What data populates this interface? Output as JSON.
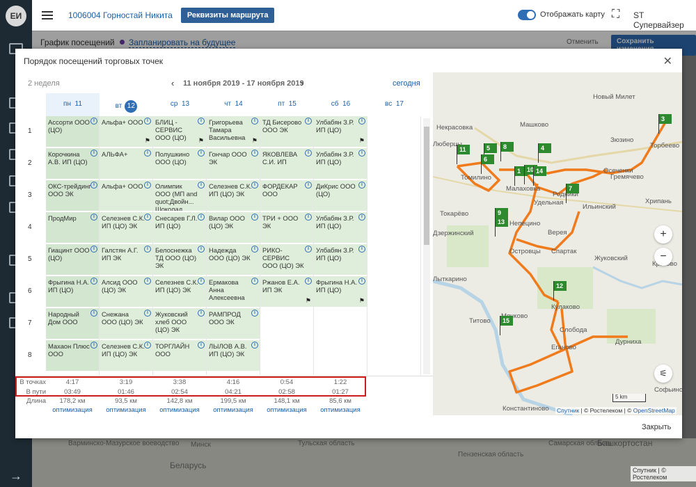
{
  "sidebar": {
    "avatar": "ЕИ"
  },
  "topbar": {
    "name": "1006004 Горностай Никита",
    "route_btn": "Реквизиты маршрута",
    "map_toggle": "Отображать карту",
    "user": "ST Супервайзер"
  },
  "subbar": {
    "title": "График посещений",
    "plan": "Запланировать на будущее",
    "cancel": "Отменить",
    "save": "Сохранить изменения"
  },
  "bg_map": {
    "l1": "Варминско-Мазурское воеводство",
    "l2": "Минск",
    "l3": "Беларусь",
    "l4": "Тульская область",
    "l5": "Пензенская область",
    "l6": "Самарская область",
    "l7": "Башкортостан",
    "attr": "Спутник | © Ростелеком"
  },
  "modal": {
    "title": "Порядок посещений торговых точек",
    "weeks": "2 неделя",
    "range": "11 ноября 2019 - 17 ноября 2019",
    "today": "сегодня",
    "close": "Закрыть",
    "days": [
      {
        "label": "пн",
        "num": "11"
      },
      {
        "label": "вт",
        "num": "12"
      },
      {
        "label": "ср",
        "num": "13"
      },
      {
        "label": "чт",
        "num": "14"
      },
      {
        "label": "пт",
        "num": "15"
      },
      {
        "label": "сб",
        "num": "16"
      },
      {
        "label": "вс",
        "num": "17"
      }
    ],
    "rows": [
      "1",
      "2",
      "3",
      "4",
      "5",
      "6",
      "7",
      "8"
    ],
    "cells": [
      [
        "Ассорти ООО (ЦО)",
        "Альфа+ ООО",
        "БЛИЦ - СЕРВИС ООО (ЦО)",
        "Григорьева Тамара Васильевна",
        "ТД Бисерово ООО ЭК",
        "Улбабян З.Р. ИП (ЦО)"
      ],
      [
        "Корочкина А.В. ИП (ЦО)",
        "АЛЬФА+",
        "Полушкино ООО (ЦО)",
        "Гончар ООО ЭК",
        "ЯКОВЛЕВА С.И. ИП",
        "Улбабян З.Р. ИП (ЦО)"
      ],
      [
        "ОКС-трейдинг ООО ЭК",
        "Альфа+ ООО",
        "Олимпик ООО (МП and quot;Двойн... Шоколад",
        "Селезнев С.К. ИП (ЦО) ЭК",
        "ФОРДЕКАР ООО",
        "ДиКрис ООО (ЦО)"
      ],
      [
        "ПродМир",
        "Селезнев С.К. ИП (ЦО) ЭК",
        "Снесарев Г.Л. ИП (ЦО)",
        "Вилар ООО (ЦО) ЭК",
        "ТРИ + ООО ЭК",
        "Улбабян З.Р. ИП (ЦО)"
      ],
      [
        "Гиацинт ООО (ЦО)",
        "Галстян А.Г. ИП ЭК",
        "Белоснежка ТД ООО (ЦО) ЭК",
        "Надежда ООО (ЦО) ЭК",
        "РИКО-СЕРВИС ООО (ЦО) ЭК",
        "Улбабян З.Р. ИП (ЦО)"
      ],
      [
        "Фрыгина Н.А. ИП (ЦО)",
        "Алсид ООО (ЦО) ЭК",
        "Селезнев С.К. ИП (ЦО) ЭК",
        "Ермакова Анна Алексеевна",
        "Ржанов Е.А. ИП ЭК",
        "Фрыгина Н.А. ИП (ЦО)"
      ],
      [
        "Народный Дом ООО",
        "Снежана ООО (ЦО) ЭК",
        "Жуковский хлеб ООО (ЦО) ЭК",
        "РАМПРОД ООО ЭК",
        "",
        ""
      ],
      [
        "Махаон Плюс ООО",
        "Селезнев С.К. ИП (ЦО) ЭК",
        "ТОРГЛАЙН ООО",
        "ЛЫЛОВ А.В. ИП (ЦО) ЭК",
        "",
        ""
      ]
    ],
    "stats": {
      "lbl_points": "В точках",
      "lbl_route": "В пути",
      "lbl_length": "Длина",
      "points": [
        "4:17",
        "3:19",
        "3:38",
        "4:16",
        "0:54",
        "1:22"
      ],
      "route": [
        "03:49",
        "01:46",
        "02:54",
        "04:21",
        "02:58",
        "01:27"
      ],
      "length": [
        "178,2 км",
        "93,5 км",
        "142,8 км",
        "199,5 км",
        "148,1 км",
        "85,6 км"
      ],
      "opt": "оптимизация"
    }
  },
  "map": {
    "labels": [
      "Некрасовка",
      "Новый Милет",
      "Машково",
      "Люберцы",
      "Зюзино",
      "Торбеево",
      "Гремячево",
      "Томилино",
      "Малаховка",
      "Родники",
      "Осеченки",
      "Токарёво",
      "Удельная",
      "Ильинский",
      "Хрипань",
      "Дзержинский",
      "Островцы",
      "Непецино",
      "Жуковский",
      "Кратово",
      "Лыткарино",
      "Спартак",
      "Титово",
      "Кулаково",
      "Мячково",
      "Слобода",
      "Дурниха",
      "Еганово",
      "Константиново",
      "Софьино",
      "Верея"
    ],
    "markers": [
      "3",
      "11",
      "5",
      "8",
      "4",
      "6",
      "1",
      "10",
      "14",
      "7",
      "9",
      "13",
      "12",
      "15"
    ],
    "scale": "5 km",
    "attr_a": "Спутник",
    "attr_b": "| © Ростелеком | ©",
    "attr_c": "OpenStreetMap",
    "zoom_in": "+",
    "zoom_out": "−",
    "settings": "⚟"
  }
}
